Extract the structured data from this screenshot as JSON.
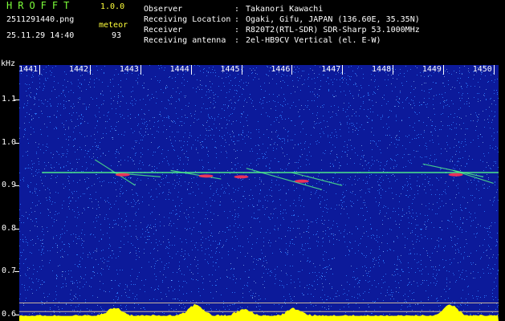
{
  "header": {
    "logo": "HROFFT",
    "version": "1.0.0",
    "filename": "2511291440.png",
    "datetime": "25.11.29 14:40",
    "meteor_label": "meteor",
    "meteor_count": "93",
    "info": [
      {
        "key": "Observer",
        "value": "Takanori Kawachi"
      },
      {
        "key": "Receiving Location",
        "value": "Ogaki, Gifu, JAPAN (136.60E, 35.35N)"
      },
      {
        "key": "Receiver",
        "value": "R820T2(RTL-SDR) SDR-Sharp 53.1000MHz"
      },
      {
        "key": "Receiving antenna",
        "value": "2el-HB9CV Vertical (el. E-W)"
      }
    ]
  },
  "plot": {
    "y_unit": "kHz",
    "x_ticks": [
      "1441",
      "1442",
      "1443",
      "1444",
      "1445",
      "1446",
      "1447",
      "1448",
      "1449",
      "1450"
    ],
    "y_ticks": [
      "1.1",
      "1.0",
      "0.9",
      "0.8",
      "0.7",
      "0.6"
    ],
    "x_range": [
      1440.6,
      1450.1
    ],
    "y_range": [
      0.585,
      1.18
    ],
    "colors": {
      "background": "#0c1a9a",
      "noise": "#2f7fff",
      "trace": "#55ff88",
      "hot": "#ff3355",
      "baseline": "#ffff00"
    }
  }
}
